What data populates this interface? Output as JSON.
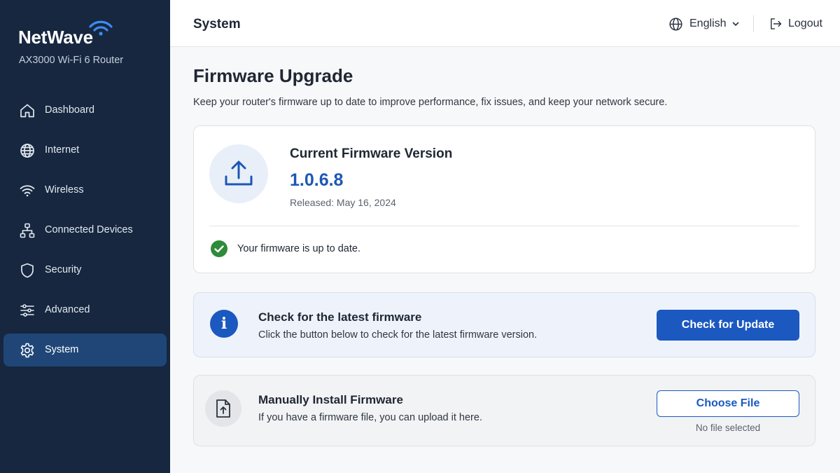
{
  "brand": {
    "name": "NetWave",
    "subtitle": "AX3000 Wi-Fi 6 Router",
    "accent_color": "#3d8bf2"
  },
  "sidebar": {
    "items": [
      {
        "label": "Dashboard",
        "icon": "home-icon",
        "active": false
      },
      {
        "label": "Internet",
        "icon": "globe-icon",
        "active": false
      },
      {
        "label": "Wireless",
        "icon": "wifi-icon",
        "active": false
      },
      {
        "label": "Connected Devices",
        "icon": "network-icon",
        "active": false
      },
      {
        "label": "Security",
        "icon": "shield-icon",
        "active": false
      },
      {
        "label": "Advanced",
        "icon": "sliders-icon",
        "active": false
      },
      {
        "label": "System",
        "icon": "gear-icon",
        "active": true
      }
    ]
  },
  "header": {
    "title": "System",
    "language": "English",
    "logout_label": "Logout"
  },
  "page": {
    "title": "Firmware Upgrade",
    "description": "Keep your router's firmware up to date to improve performance, fix issues, and keep your network secure."
  },
  "current_firmware": {
    "title": "Current Firmware Version",
    "version": "1.0.6.8",
    "released": "Released: May 16, 2024",
    "status": "Your firmware is up to date.",
    "status_color": "#2e8b3a"
  },
  "check_update": {
    "title": "Check for the latest firmware",
    "description": "Click the button below to check for the latest firmware version.",
    "button_label": "Check for Update"
  },
  "manual_install": {
    "title": "Manually Install Firmware",
    "description": "If you have a firmware file, you can upload it here.",
    "button_label": "Choose File",
    "file_status": "No file selected"
  },
  "colors": {
    "sidebar_bg": "#16273f",
    "sidebar_active": "#1f4677",
    "primary": "#1b58c0"
  }
}
